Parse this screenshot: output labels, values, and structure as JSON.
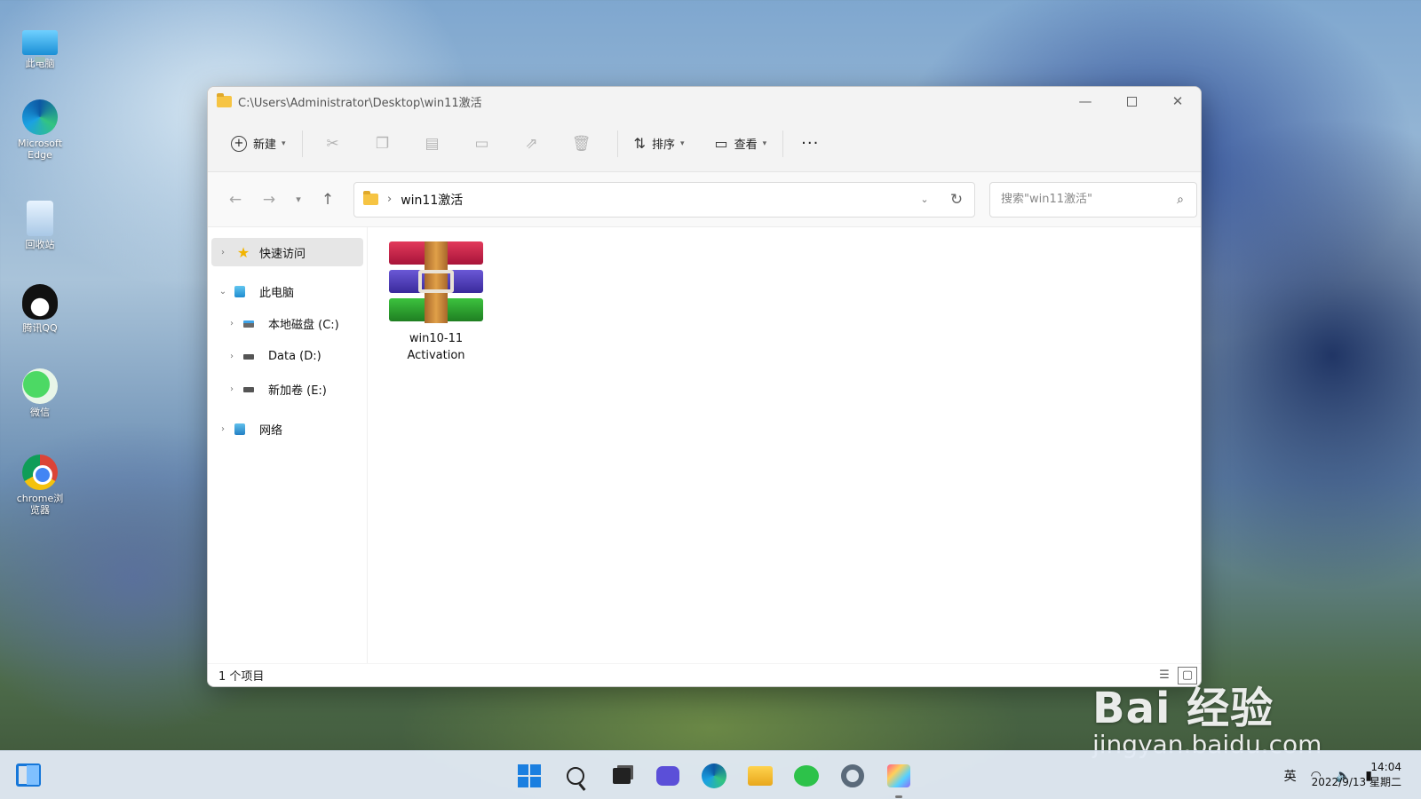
{
  "desktop": {
    "icons": [
      {
        "label": "此电脑",
        "icon": "this-pc-icon"
      },
      {
        "label": "Microsoft Edge",
        "icon": "edge-icon"
      },
      {
        "label": "回收站",
        "icon": "recycle-bin-icon"
      },
      {
        "label": "腾讯QQ",
        "icon": "qq-icon"
      },
      {
        "label": "微信",
        "icon": "wechat-icon"
      },
      {
        "label": "chrome浏览器",
        "icon": "chrome-icon"
      }
    ]
  },
  "window": {
    "title": "C:\\Users\\Administrator\\Desktop\\win11激活",
    "ribbon": {
      "new_label": "新建",
      "sort_label": "排序",
      "view_label": "查看",
      "more_label": "···"
    },
    "nav": {
      "address_folder": "win11激活",
      "search_placeholder": "搜索\"win11激活\""
    },
    "sidebar": {
      "quick_access": "快速访问",
      "this_pc": "此电脑",
      "drive_c": "本地磁盘 (C:)",
      "drive_d": "Data (D:)",
      "drive_e": "新加卷 (E:)",
      "network": "网络"
    },
    "files": [
      {
        "name_line1": "win10-11",
        "name_line2": "Activation",
        "icon": "winrar-archive-icon"
      }
    ],
    "status": {
      "item_count": "1 个项目"
    }
  },
  "watermark": {
    "logo_text": "Bai 经验",
    "url": "jingyan.baidu.com"
  },
  "taskbar": {
    "ime": "英",
    "time": "14:04",
    "date": "2022/9/13 星期二"
  },
  "colors": {
    "accent": "#1a7fe0",
    "folder": "#f6c443",
    "window_bg": "#ffffff",
    "ribbon_bg": "#f3f3f3"
  }
}
